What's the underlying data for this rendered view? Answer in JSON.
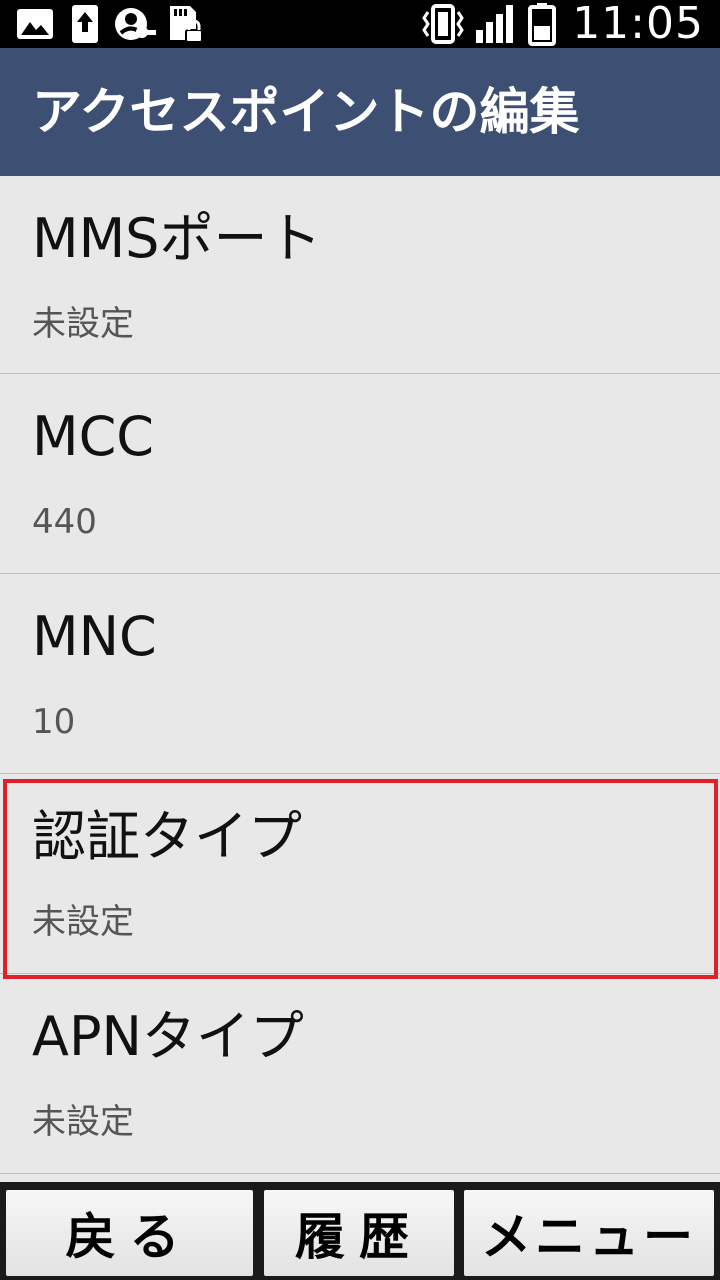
{
  "status_bar": {
    "time": "11:05",
    "icons": [
      "gallery-icon",
      "upload-icon",
      "account-key-icon",
      "sd-card-locked-icon",
      "vibrate-icon",
      "signal-icon",
      "battery-icon"
    ]
  },
  "app_bar": {
    "title": "アクセスポイントの編集"
  },
  "settings": [
    {
      "title": "MMSポート",
      "value": "未設定"
    },
    {
      "title": "MCC",
      "value": "440"
    },
    {
      "title": "MNC",
      "value": "10"
    },
    {
      "title": "認証タイプ",
      "value": "未設定"
    },
    {
      "title": "APNタイプ",
      "value": "未設定"
    }
  ],
  "highlighted_item": "認証タイプ",
  "highlight_color": "#e0202a",
  "bottom_bar": {
    "back_label": "戻る",
    "history_label": "履歴",
    "menu_label": "メニュー"
  },
  "colors": {
    "app_bar": "#3d4f72",
    "list_background": "#e8e8e8"
  }
}
